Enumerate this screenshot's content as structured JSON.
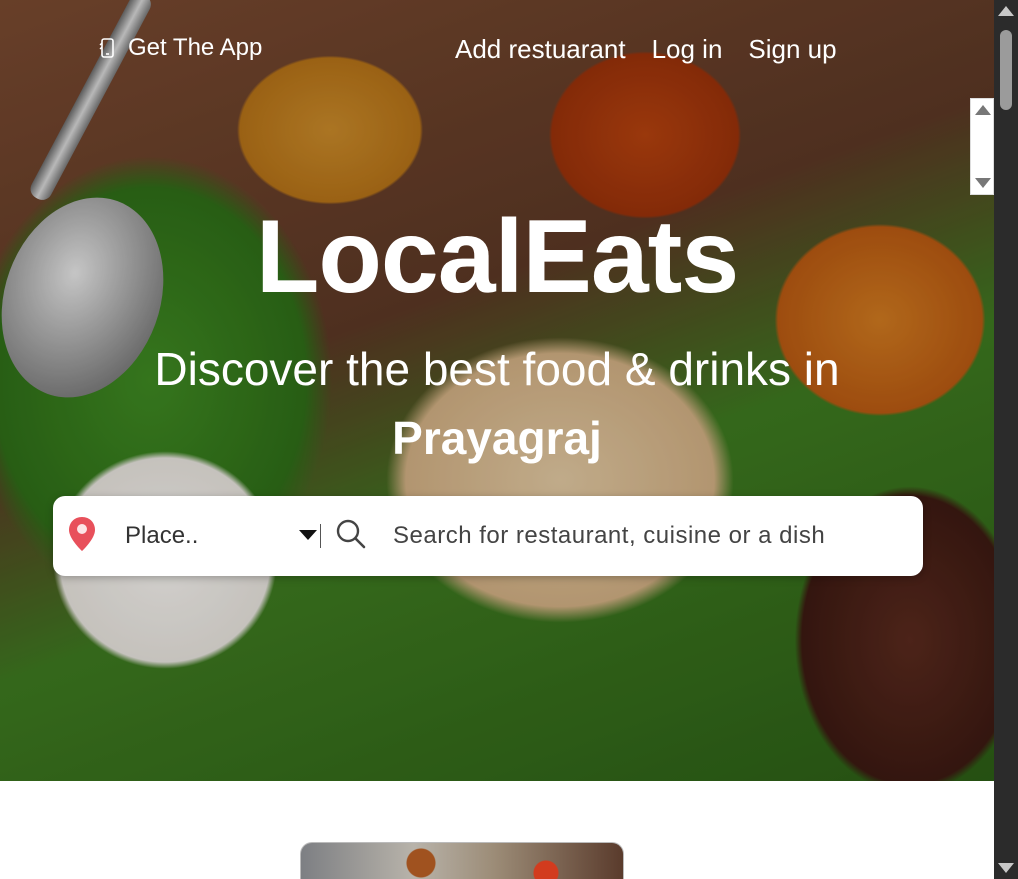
{
  "nav": {
    "get_app_label": "Get The App",
    "links": [
      {
        "label": "Add restuarant"
      },
      {
        "label": "Log in"
      },
      {
        "label": "Sign up"
      }
    ]
  },
  "hero": {
    "brand": "LocalEats",
    "tagline": "Discover the best food & drinks in",
    "city": "Prayagraj"
  },
  "search": {
    "place_label": "Place..",
    "placeholder": "Search for restaurant, cuisine or a dish"
  },
  "icons": {
    "phone": "phone-icon",
    "pin": "location-pin-icon",
    "search": "search-icon",
    "caret": "chevron-down-icon"
  },
  "colors": {
    "pin": "#e8505b",
    "nav_text": "#ffffff",
    "scrollbar": "#2b2b2b"
  }
}
